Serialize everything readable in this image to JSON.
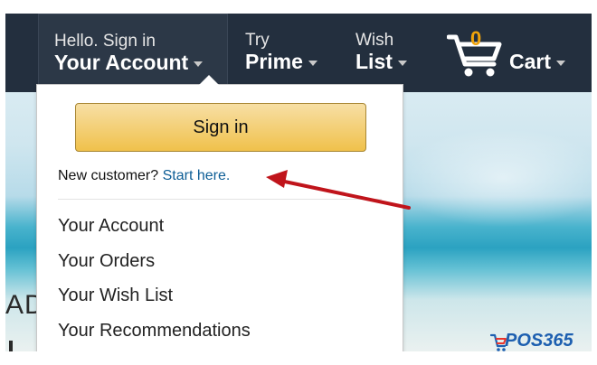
{
  "nav": {
    "account": {
      "line1": "Hello. Sign in",
      "line2": "Your Account"
    },
    "prime": {
      "line1": "Try",
      "line2": "Prime"
    },
    "wishlist": {
      "line1": "Wish",
      "line2": "List"
    },
    "cart": {
      "count": "0",
      "label": "Cart"
    }
  },
  "dropdown": {
    "signin_label": "Sign in",
    "new_customer_text": "New customer?",
    "start_here_link": "Start here.",
    "items": [
      "Your Account",
      "Your Orders",
      "Your Wish List",
      "Your Recommendations"
    ]
  },
  "hero": {
    "partial_text": "AD"
  },
  "watermark": {
    "brand": "POS365"
  },
  "colors": {
    "nav_bg": "#232f3e",
    "signin_button": "#f0c14b",
    "link": "#0e5e96",
    "annotation_arrow": "#c0141b",
    "cart_count": "#f0a30a"
  }
}
